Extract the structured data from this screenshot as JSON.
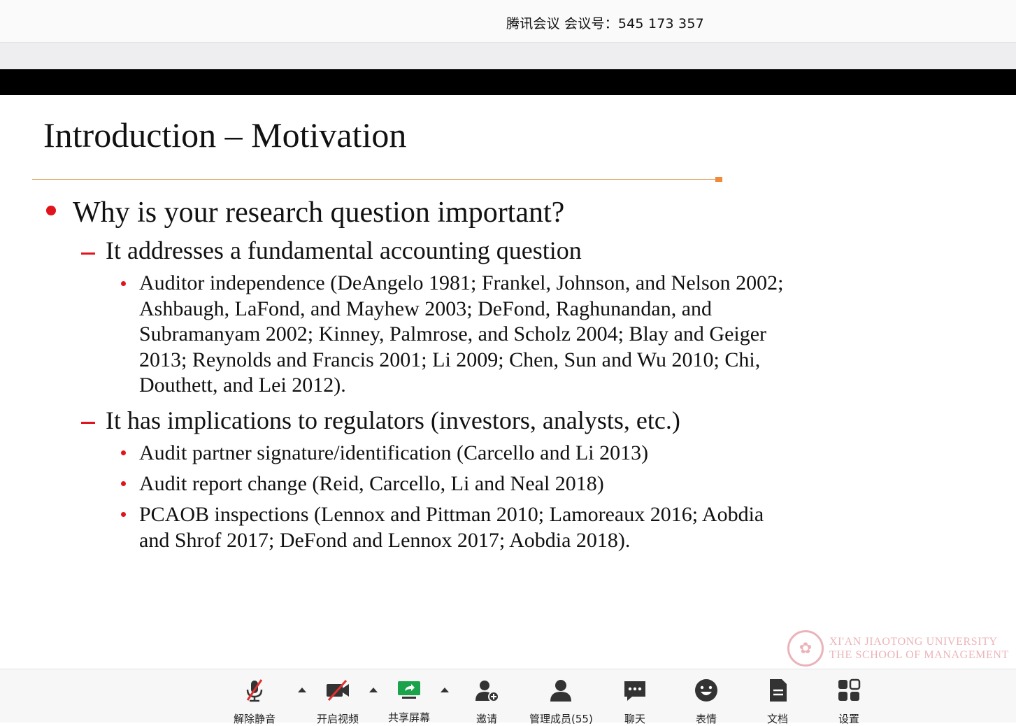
{
  "meeting": {
    "title": "腾讯会议 会议号：545 173 357"
  },
  "slide": {
    "title": "Introduction – Motivation",
    "bullets": {
      "q": "Why is your research question important?",
      "sub1": "It addresses a fundamental accounting question",
      "sub1_items": [
        "Auditor independence (DeAngelo 1981; Frankel, Johnson, and Nelson 2002; Ashbaugh, LaFond, and Mayhew 2003; DeFond, Raghunandan, and Subramanyam 2002; Kinney, Palmrose, and Scholz 2004; Blay and Geiger 2013; Reynolds and Francis 2001; Li 2009; Chen, Sun and Wu 2010; Chi, Douthett, and Lei 2012)."
      ],
      "sub2": "It has implications to regulators (investors, analysts, etc.)",
      "sub2_items": [
        "Audit partner signature/identification (Carcello and Li 2013)",
        "Audit report change (Reid, Carcello, Li and Neal 2018)",
        "PCAOB inspections (Lennox and Pittman 2010; Lamoreaux 2016; Aobdia and Shrof 2017; DeFond and Lennox 2017; Aobdia 2018)."
      ]
    },
    "watermark": {
      "line1": "XI'AN JIAOTONG UNIVERSITY",
      "line2": "THE SCHOOL OF MANAGEMENT"
    }
  },
  "toolbar": {
    "unmute": "解除静音",
    "video": "开启视频",
    "share": "共享屏幕",
    "invite": "邀请",
    "members": "管理成员(55)",
    "chat": "聊天",
    "emoji": "表情",
    "docs": "文档",
    "settings": "设置"
  },
  "colors": {
    "bullet_red": "#e0141c",
    "rule_orange": "#e7a768",
    "share_green": "#1aa34a",
    "mute_red": "#e0312f"
  }
}
